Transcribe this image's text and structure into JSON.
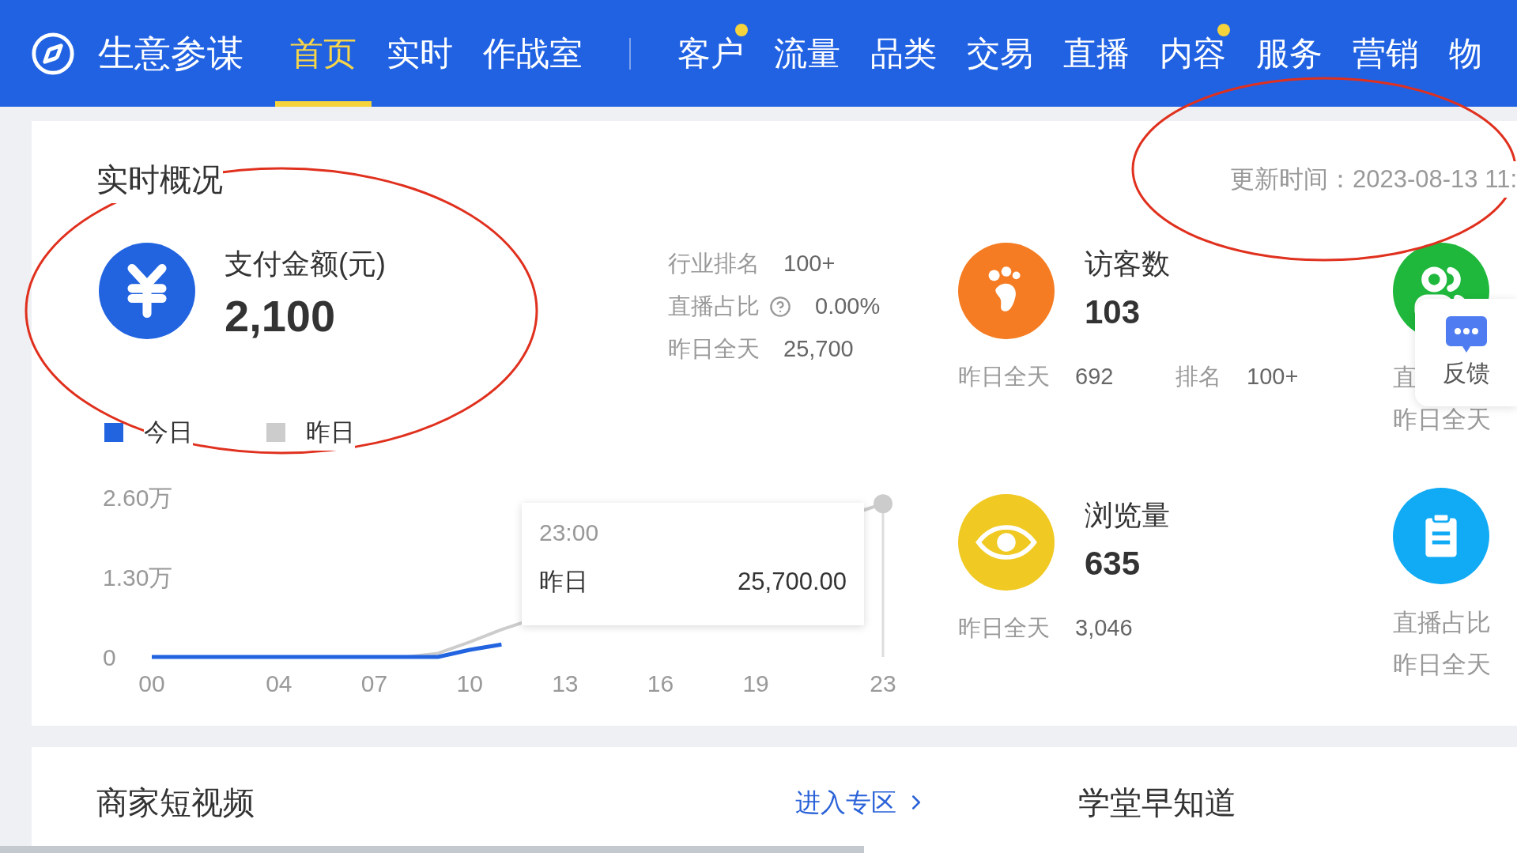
{
  "header": {
    "title": "生意参谋",
    "main_tabs": [
      {
        "label": "首页",
        "selected": true,
        "badge": false
      },
      {
        "label": "实时",
        "selected": false,
        "badge": false
      },
      {
        "label": "作战室",
        "selected": false,
        "badge": false
      }
    ],
    "module_tabs": [
      {
        "label": "客户",
        "selected": false,
        "badge": true
      },
      {
        "label": "流量",
        "selected": false,
        "badge": false
      },
      {
        "label": "品类",
        "selected": false,
        "badge": false
      },
      {
        "label": "交易",
        "selected": false,
        "badge": false
      },
      {
        "label": "直播",
        "selected": false,
        "badge": false
      },
      {
        "label": "内容",
        "selected": false,
        "badge": true
      },
      {
        "label": "服务",
        "selected": false,
        "badge": false
      },
      {
        "label": "营销",
        "selected": false,
        "badge": false
      },
      {
        "label": "物",
        "selected": false,
        "badge": false
      }
    ]
  },
  "overview": {
    "title": "实时概况",
    "update_time": "更新时间：2023-08-13 11:",
    "payment": {
      "label": "支付金额(元)",
      "value": "2,100",
      "color": "#2264e0"
    },
    "side_stats": [
      {
        "label": "行业排名",
        "value": "100+",
        "help": false
      },
      {
        "label": "直播占比",
        "value": "0.00%",
        "help": true
      },
      {
        "label": "昨日全天",
        "value": "25,700",
        "help": false
      }
    ],
    "chart_data": {
      "type": "line",
      "x": [
        0,
        1,
        2,
        3,
        4,
        5,
        6,
        7,
        8,
        9,
        10,
        11,
        12,
        13,
        14,
        15,
        16,
        17,
        18,
        19,
        20,
        21,
        22,
        23
      ],
      "series": [
        {
          "name": "今日",
          "color": "#2264e0",
          "values": [
            0,
            0,
            0,
            0,
            0,
            0,
            0,
            0,
            0,
            0,
            0.12,
            0.21,
            null,
            null,
            null,
            null,
            null,
            null,
            null,
            null,
            null,
            null,
            null,
            null
          ]
        },
        {
          "name": "昨日",
          "color": "#cccccc",
          "values": [
            null,
            null,
            null,
            null,
            null,
            null,
            null,
            0,
            0,
            0.06,
            0.25,
            0.46,
            null,
            null,
            null,
            null,
            null,
            null,
            null,
            null,
            null,
            null,
            null,
            2.57
          ]
        }
      ],
      "xlim": [
        0,
        23
      ],
      "xticks": [
        {
          "value": 0,
          "label": "00"
        },
        {
          "value": 4,
          "label": "04"
        },
        {
          "value": 7,
          "label": "07"
        },
        {
          "value": 10,
          "label": "10"
        },
        {
          "value": 13,
          "label": "13"
        },
        {
          "value": 16,
          "label": "16"
        },
        {
          "value": 19,
          "label": "19"
        },
        {
          "value": 23,
          "label": "23"
        }
      ],
      "yticks": [
        {
          "value": 0,
          "label": "0"
        },
        {
          "value": 1.3,
          "label": "1.30万"
        },
        {
          "value": 2.6,
          "label": "2.60万"
        }
      ],
      "ylim": [
        0,
        2.6
      ]
    },
    "tooltip": {
      "time": "23:00",
      "series": "昨日",
      "value": "25,700.00"
    },
    "metrics": [
      {
        "kind": "footprint",
        "color": "#f57c22",
        "label": "访客数",
        "value": "103",
        "details": [
          {
            "label": "昨日全天",
            "value": "692"
          },
          {
            "label": "排名",
            "value": "100+"
          }
        ]
      },
      {
        "kind": "eye",
        "color": "#f0c923",
        "label": "浏览量",
        "value": "635",
        "details": [
          {
            "label": "昨日全天",
            "value": "3,046"
          }
        ]
      }
    ],
    "side_metrics": [
      {
        "kind": "people",
        "color": "#1fb83c",
        "lines": [
          "直",
          "昨日全天"
        ]
      },
      {
        "kind": "clipboard",
        "color": "#10aaf5",
        "lines": [
          "直播占比",
          "昨日全天"
        ]
      }
    ]
  },
  "feedback": {
    "label": "反馈"
  },
  "bottom_card": {
    "title": "商家短视频",
    "link": "进入专区",
    "aside_title": "学堂早知道"
  },
  "markup": [
    {
      "kind": "ellipse"
    },
    {
      "kind": "ellipse"
    }
  ]
}
